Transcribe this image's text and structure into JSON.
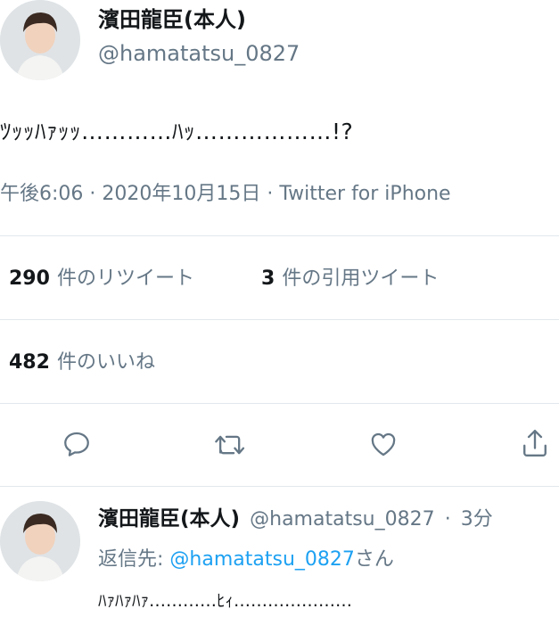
{
  "tweet": {
    "author_name": "濱田龍臣(本人)",
    "author_handle": "@hamatatsu_0827",
    "text": "ﾂｯｯﾊｧｯｯ…………ﾊｯ………………!?",
    "timestamp": "午後6:06 · 2020年10月15日 · Twitter for iPhone",
    "retweet_count": "290",
    "retweet_label": "件のリツイート",
    "quote_count": "3",
    "quote_label": "件の引用ツイート",
    "like_count": "482",
    "like_label": "件のいいね"
  },
  "actions": [
    "reply-icon",
    "retweet-icon",
    "like-icon",
    "share-icon"
  ],
  "reply": {
    "author_name": "濱田龍臣(本人)",
    "author_handle": "@hamatatsu_0827",
    "separator": "·",
    "time_ago": "3分",
    "replying_to_prefix": "返信先:",
    "replying_to_handle": "@hamatatsu_0827",
    "replying_to_suffix": "さん",
    "text": "ﾊｧﾊｧﾊｧ…………ﾋｨ…………………"
  },
  "colors": {
    "text": "#14171a",
    "secondary": "#657786",
    "accent": "#1da1f2",
    "divider": "#e1e8ed"
  }
}
